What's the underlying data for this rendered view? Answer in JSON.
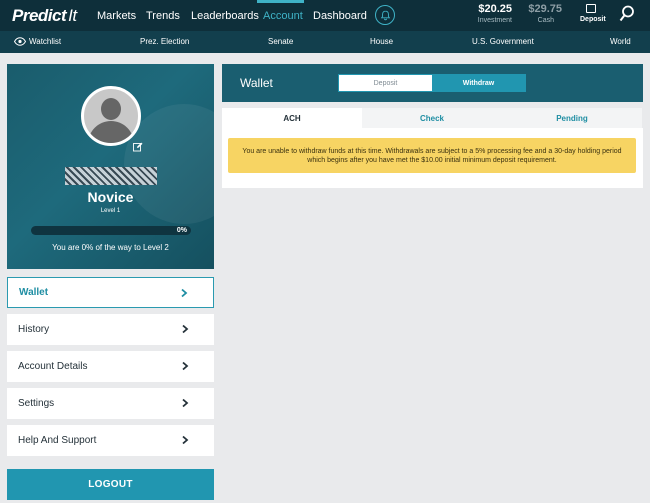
{
  "nav": {
    "logo_main": "Predict",
    "logo_it": "It",
    "links": [
      "Markets",
      "Trends",
      "Leaderboards",
      "Account",
      "Dashboard"
    ],
    "active_link": "Account",
    "investment_amount": "$20.25",
    "investment_label": "Investment",
    "cash_amount": "$29.75",
    "cash_label": "Cash",
    "deposit_label": "Deposit",
    "icons": {
      "bell": "bell-icon",
      "search": "search-icon",
      "deposit": "wallet-icon"
    },
    "accent_color": "#3fb3c7"
  },
  "subnav": {
    "watchlist": "Watchlist",
    "items": [
      "Prez. Election",
      "Senate",
      "House",
      "U.S. Government",
      "World"
    ]
  },
  "profile": {
    "rank": "Novice",
    "level": "Level 1",
    "progress_percent": 0,
    "progress_label": "0%",
    "progress_text": "You are 0% of the way to Level 2"
  },
  "menu": {
    "items": [
      "Wallet",
      "History",
      "Account Details",
      "Settings",
      "Help And Support"
    ],
    "active": "Wallet",
    "logout": "LOGOUT"
  },
  "wallet": {
    "title": "Wallet",
    "toggle_deposit": "Deposit",
    "toggle_withdraw": "Withdraw",
    "tabs": [
      "ACH",
      "Check",
      "Pending"
    ],
    "active_tab": "ACH",
    "notice": "You are unable to withdraw funds at this time. Withdrawals are subject to a 5% processing fee and a 30-day holding period which begins after you have met the $10.00 initial minimum deposit requirement.",
    "notice_color": "#f7d463"
  }
}
